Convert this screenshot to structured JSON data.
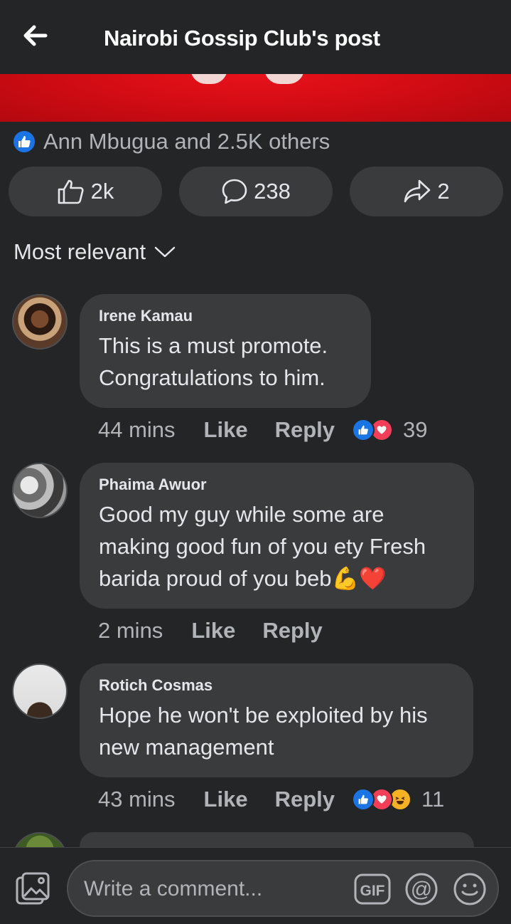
{
  "header": {
    "title": "Nairobi Gossip Club's post"
  },
  "post": {
    "reaction_summary": "Ann Mbugua and 2.5K others",
    "actions": {
      "like_count": "2k",
      "comment_count": "238",
      "share_count": "2"
    }
  },
  "sort": {
    "label": "Most relevant"
  },
  "comments": [
    {
      "author": "Irene Kamau",
      "lines": [
        "This is a must promote.",
        "Congratulations to him."
      ],
      "time": "44 mins",
      "like": "Like",
      "reply": "Reply",
      "reactions": [
        "like",
        "love"
      ],
      "reaction_count": "39"
    },
    {
      "author": "Phaima Awuor",
      "lines": [
        "Good my guy while some are",
        "making good fun of you ety Fresh",
        "barida proud of you beb💪❤️"
      ],
      "time": "2 mins",
      "like": "Like",
      "reply": "Reply",
      "reactions": [],
      "reaction_count": ""
    },
    {
      "author": "Rotich Cosmas",
      "lines": [
        "Hope he won't be exploited by his",
        "new management"
      ],
      "time": "43 mins",
      "like": "Like",
      "reply": "Reply",
      "reactions": [
        "like",
        "love",
        "haha"
      ],
      "reaction_count": "11"
    }
  ],
  "composer": {
    "placeholder": "Write a comment..."
  },
  "colors": {
    "background": "#242526",
    "surface": "#3a3b3c",
    "like_blue": "#1b74e4",
    "love_red": "#f33e58",
    "haha_yellow": "#f7b125",
    "banner_red": "#d40c14"
  },
  "icons": [
    "back-arrow-icon",
    "like-icon",
    "comment-icon",
    "share-icon",
    "chevron-down-icon",
    "gallery-icon",
    "gif-icon",
    "mention-icon",
    "emoji-icon"
  ]
}
